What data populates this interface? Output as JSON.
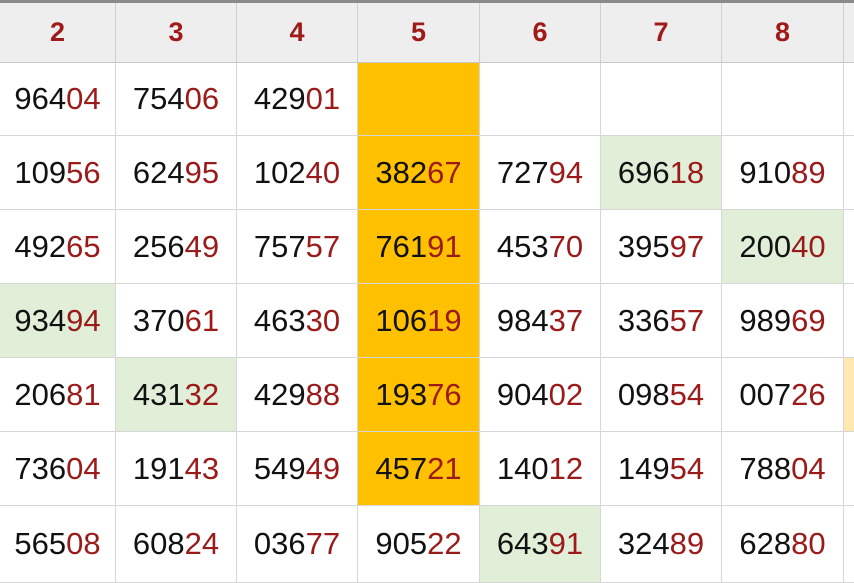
{
  "headers": [
    "2",
    "3",
    "4",
    "5",
    "6",
    "7",
    "8"
  ],
  "rows": [
    [
      "96404",
      "75406",
      "42901",
      "",
      "",
      "",
      ""
    ],
    [
      "10956",
      "62495",
      "10240",
      "38267",
      "72794",
      "69618",
      "91089"
    ],
    [
      "49265",
      "25649",
      "75757",
      "76191",
      "45370",
      "39597",
      "20040"
    ],
    [
      "93494",
      "37061",
      "46330",
      "10619",
      "98437",
      "33657",
      "98969"
    ],
    [
      "20681",
      "43132",
      "42988",
      "19376",
      "90402",
      "09854",
      "00726"
    ],
    [
      "73604",
      "19143",
      "54949",
      "45721",
      "14012",
      "14954",
      "78804"
    ],
    [
      "56508",
      "60824",
      "03677",
      "90522",
      "64391",
      "32489",
      "62880"
    ]
  ],
  "highlights": {
    "green": [
      [
        1,
        5
      ],
      [
        2,
        6
      ],
      [
        3,
        0
      ],
      [
        4,
        1
      ],
      [
        6,
        4
      ]
    ],
    "orange": [
      [
        0,
        3
      ],
      [
        1,
        3
      ],
      [
        2,
        3
      ],
      [
        3,
        3
      ],
      [
        4,
        3
      ],
      [
        5,
        3
      ]
    ],
    "pale": [
      [
        4,
        7
      ]
    ]
  },
  "colors": {
    "header_text": "#a01a1a",
    "tail_digits": "#9b1a1a",
    "green_highlight": "#e1efd9",
    "orange_highlight": "#ffc000"
  }
}
